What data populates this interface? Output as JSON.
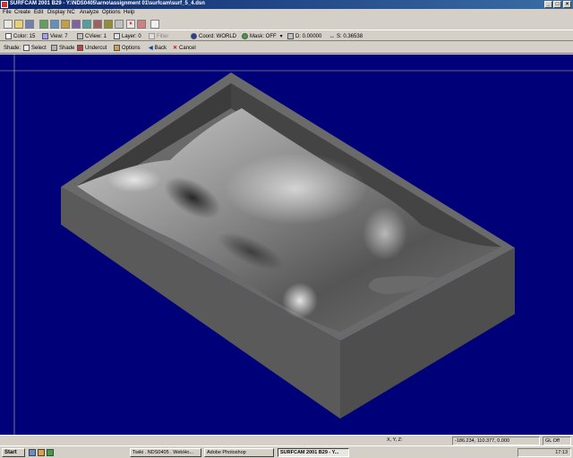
{
  "titlebar": {
    "title": "SURFCAM 2001 B29 - Y:\\NDS0405\\arno\\assignment 01\\surfcam\\surf_5_4.dsn",
    "min": "_",
    "max": "□",
    "close": "×"
  },
  "menu": [
    "File",
    "Create",
    "Edit",
    "Display",
    "NC",
    "Analyze",
    "Options",
    "Help"
  ],
  "toolbar2": {
    "color": "Color: 15",
    "view": "View: 7",
    "cview": "CView: 1",
    "layer": "Layer: 0",
    "filter": "Filter",
    "coord": "Coord: WORLD",
    "mask": "Mask: OFF",
    "d": "D: 0.00000",
    "s": "S: 0.36538"
  },
  "toolbar3": {
    "shade_label": "Shade:",
    "select": "Select",
    "shade": "Shade",
    "undercut": "Undercut",
    "options": "Options",
    "back": "Back",
    "cancel": "Cancel"
  },
  "status": {
    "xyz_label": "X, Y, Z:",
    "coords": "-186.234, 110.377, 0.000",
    "gl": "GL Off"
  },
  "taskbar": {
    "start": "Start",
    "tasks": [
      "Twiki . NDS0405 . WebHo...",
      "Adobe Photoshop",
      "SURFCAM 2001 B29 - Y..."
    ],
    "clock": "17:13"
  },
  "colors": {
    "viewport_bg": "#000078",
    "titlebar": "#0a246a",
    "solid": "#5a5a5a"
  }
}
